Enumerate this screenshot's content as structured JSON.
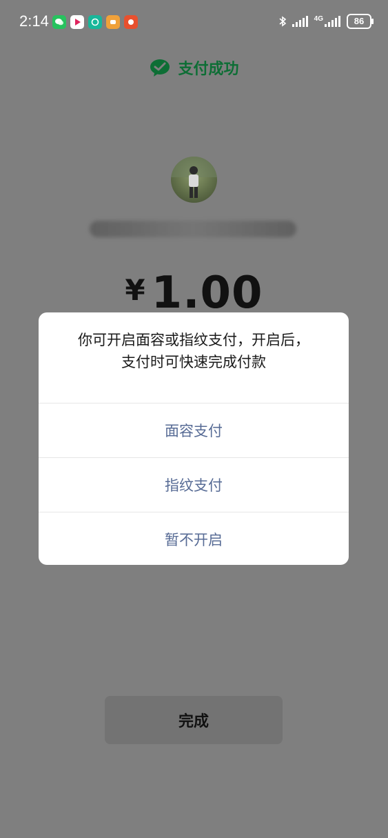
{
  "status_bar": {
    "time": "2:14",
    "network": "4G",
    "battery": "86",
    "notification_icons": [
      "wechat-icon",
      "video-app-icon",
      "xiaomi-app-icon",
      "game-app-icon",
      "shopping-app-icon"
    ]
  },
  "header": {
    "title": "支付成功",
    "accent_color": "#0d6e35"
  },
  "payment": {
    "amount": "1.00",
    "currency_symbol": "¥"
  },
  "dialog": {
    "message_line1": "你可开启面容或指纹支付，开启后，",
    "message_line2": "支付时可快速完成付款",
    "options": [
      {
        "label": "面容支付"
      },
      {
        "label": "指纹支付"
      },
      {
        "label": "暂不开启"
      }
    ],
    "option_color": "#576b95"
  },
  "footer": {
    "done_label": "完成"
  }
}
